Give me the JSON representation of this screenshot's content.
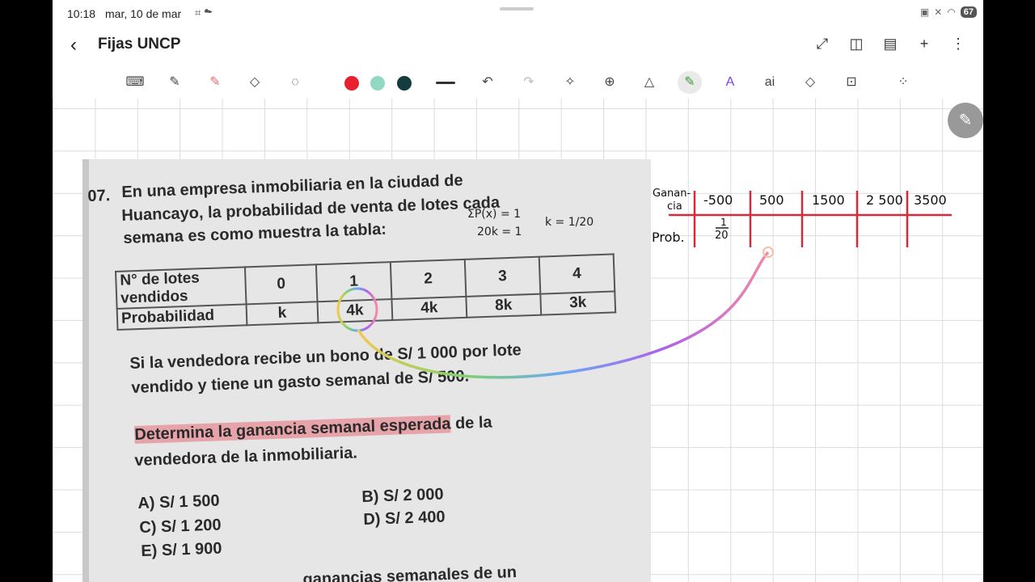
{
  "status": {
    "time": "10:18",
    "date": "mar, 10 de mar",
    "battery": "67"
  },
  "app": {
    "title": "Fijas UNCP"
  },
  "toolbar": {
    "colors": [
      "#e8202e",
      "#93d8c2",
      "#143c3e"
    ]
  },
  "problem": {
    "number": "07.",
    "lines": [
      "En una empresa inmobiliaria en la ciudad de",
      "Huancayo, la probabilidad de venta de lotes cada",
      "semana es como muestra la tabla:"
    ],
    "table": {
      "row1_label_a": "N° de lotes",
      "row1_label_b": "vendidos",
      "row2_label": "Probabilidad",
      "columns": [
        "0",
        "1",
        "2",
        "3",
        "4"
      ],
      "probabilities": [
        "k",
        "4k",
        "4k",
        "8k",
        "3k"
      ]
    },
    "text2": [
      "Si la vendedora recibe un bono de S/ 1 000 por lote",
      "vendido y tiene un gasto semanal de S/ 500."
    ],
    "question_highlight": "Determina la ganancia semanal esperada",
    "question_rest_1": " de la",
    "question_rest_2": "vendedora de la inmobiliaria.",
    "options": {
      "a": "A) S/ 1 500",
      "b": "B) S/ 2 000",
      "c": "C) S/ 1 200",
      "d": "D) S/ 2 400",
      "e": "E) S/ 1 900"
    },
    "bottom_cut": "... ganancias semanales de un"
  },
  "handwriting": {
    "eq1": "ΣP(x) = 1",
    "eq2": "20k = 1",
    "eq3": "k = 1/20",
    "gan_label_a": "Ganan-",
    "gan_label_b": "cia",
    "prob_label": "Prob.",
    "gains": [
      "-500",
      "500",
      "1500",
      "2 500",
      "3500"
    ],
    "first_prob_num": "1",
    "first_prob_den": "20"
  }
}
